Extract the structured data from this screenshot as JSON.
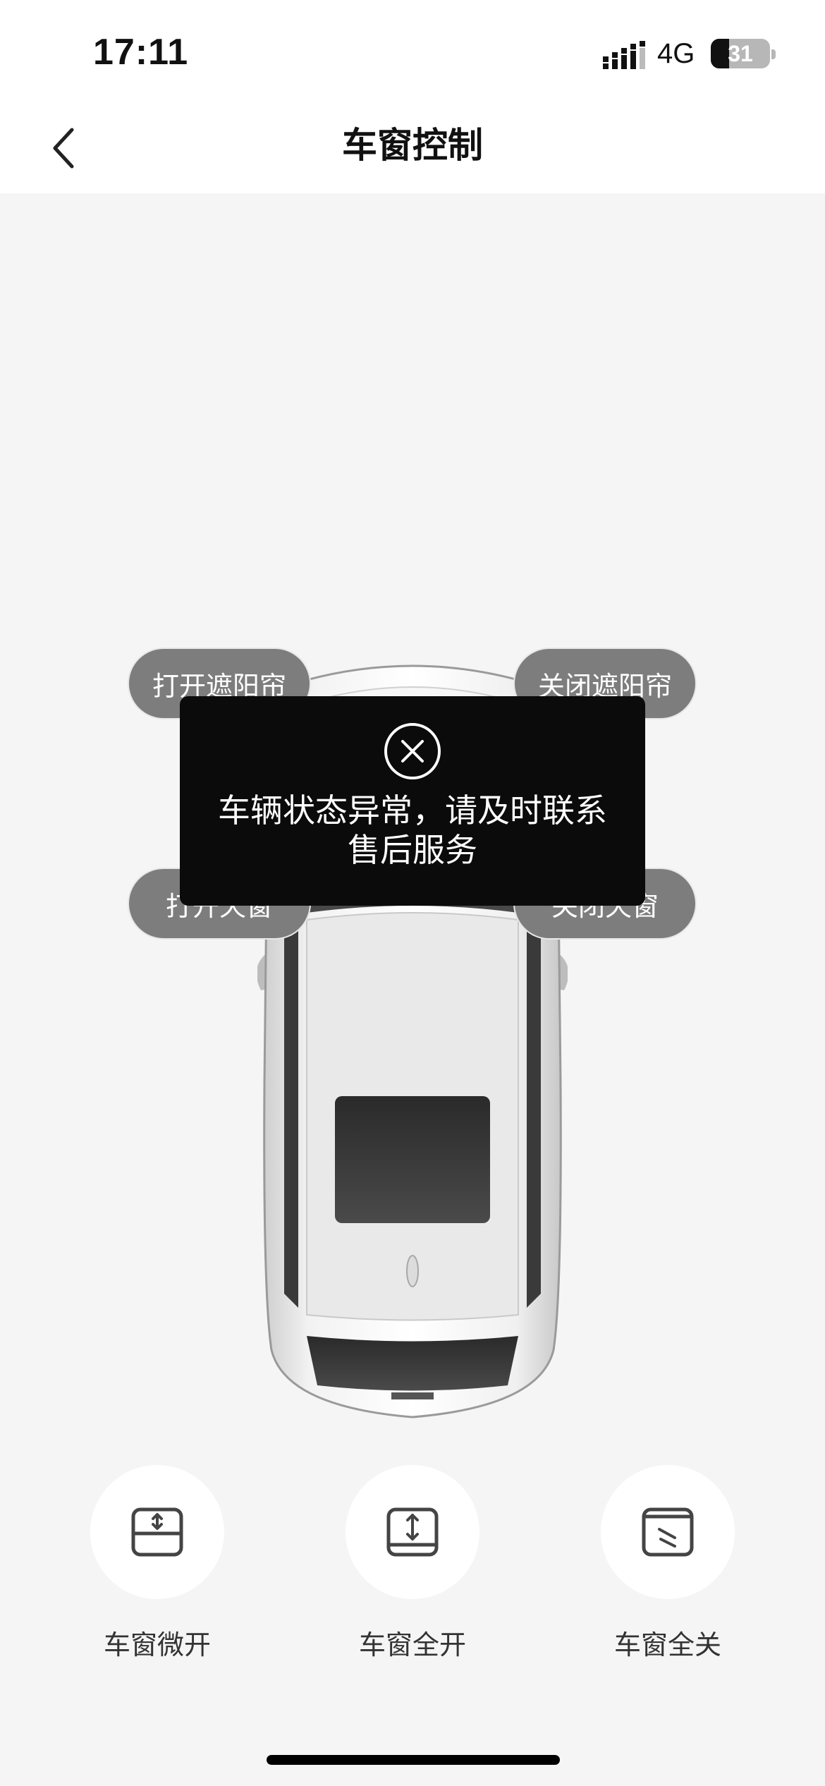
{
  "status_bar": {
    "time": "17:11",
    "network": "4G",
    "battery": "31",
    "battery_level_percent": 31
  },
  "nav": {
    "title": "车窗控制",
    "back_icon": "chevron-left-icon"
  },
  "car_controls": {
    "open_sunshade": "打开遮阳帘",
    "close_sunshade": "关闭遮阳帘",
    "open_sunroof": "打开天窗",
    "close_sunroof": "关闭天窗"
  },
  "toast": {
    "icon": "close-circle-icon",
    "message_line1": "车辆状态异常，请及时联系",
    "message_line2": "售后服务"
  },
  "actions": [
    {
      "label": "车窗微开",
      "icon": "window-vent-icon"
    },
    {
      "label": "车窗全开",
      "icon": "window-open-icon"
    },
    {
      "label": "车窗全关",
      "icon": "window-close-icon"
    }
  ],
  "colors": {
    "page_background": "#f5f5f5",
    "pill_background": "#7d7d7d",
    "toast_background": "#0b0b0b"
  }
}
